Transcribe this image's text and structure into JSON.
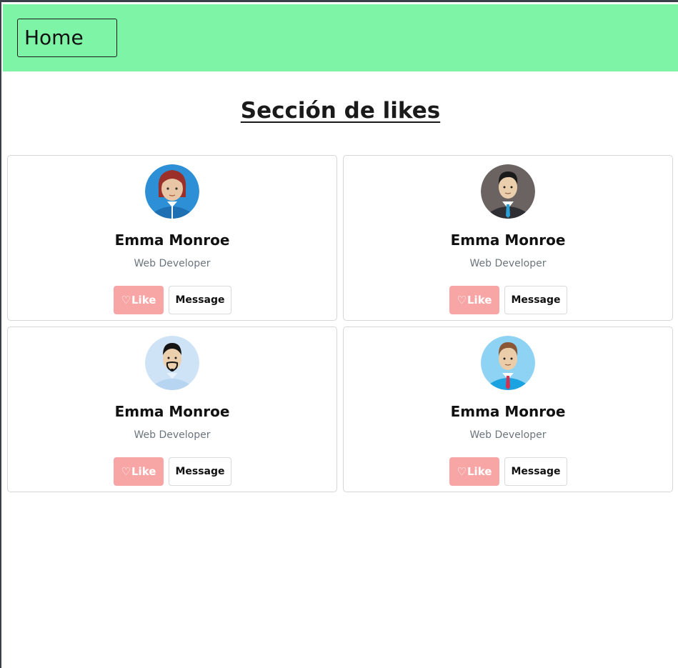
{
  "header": {
    "home_label": "Home",
    "background": "#7ef4a6"
  },
  "page": {
    "title": "Sección de likes"
  },
  "cards": [
    {
      "name": "Emma Monroe",
      "role": "Web Developer",
      "like_label": "Like",
      "message_label": "Message",
      "avatar": "woman-red-hair-avatar"
    },
    {
      "name": "Emma Monroe",
      "role": "Web Developer",
      "like_label": "Like",
      "message_label": "Message",
      "avatar": "man-black-suit-avatar"
    },
    {
      "name": "Emma Monroe",
      "role": "Web Developer",
      "like_label": "Like",
      "message_label": "Message",
      "avatar": "man-goatee-avatar"
    },
    {
      "name": "Emma Monroe",
      "role": "Web Developer",
      "like_label": "Like",
      "message_label": "Message",
      "avatar": "man-red-tie-avatar"
    }
  ],
  "icons": {
    "like": "heart-icon"
  },
  "colors": {
    "like_button": "#f8a5a5",
    "role_text": "#6c757d"
  }
}
